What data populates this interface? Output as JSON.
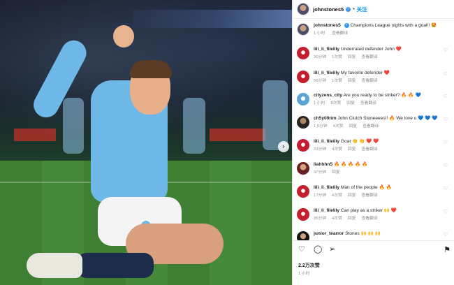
{
  "post": {
    "author": "johnstones5",
    "separator": "•",
    "follow_label": "关注",
    "likes": "2.2万次赞",
    "time": "1 小时"
  },
  "icons": {
    "like": "heart-icon",
    "comment": "comment-icon",
    "share": "send-icon",
    "save": "bookmark-icon",
    "verified": "verified-badge-icon",
    "next_slide": "chevron-right-icon"
  },
  "caption": {
    "user": "johnstones5",
    "text": "Champions League nights with a goal!! 🤩",
    "time": "1 小时",
    "translate": "查看翻译"
  },
  "comments": [
    {
      "user": "lili_li_filelily",
      "text": "Underrated defender John ❤️",
      "time": "30分钟",
      "likes": "1次赞",
      "reply": "回复",
      "translate": "查看翻译",
      "avatar": "red"
    },
    {
      "user": "lili_li_filelily",
      "text": "My favorite defender ❤️",
      "time": "56分钟",
      "likes": "1次赞",
      "reply": "回复",
      "translate": "查看翻译",
      "avatar": "red"
    },
    {
      "user": "cityzens_city",
      "text": "Are you ready to be striker? 🔥 🔥 💙",
      "time": "1 小时",
      "likes": "8次赞",
      "reply": "回复",
      "translate": "查看翻译",
      "avatar": "blue"
    },
    {
      "user": "ch5y09rim",
      "text": "John Clutch Stoneeees!! 🔥 We love u 💙 💙 💙",
      "time": "1 5分钟",
      "likes": "4次赞",
      "reply": "回复",
      "translate": "查看翻译",
      "avatar": "dark"
    },
    {
      "user": "lili_li_filelily",
      "text": "Goat 👏 👏 ❤️ ❤️",
      "time": "33分钟",
      "likes": "4次赞",
      "reply": "回复",
      "translate": "查看翻译",
      "avatar": "red"
    },
    {
      "user": "liahhhn5",
      "text": "🔥 🔥 🔥 🔥 🔥",
      "time": "37分钟",
      "likes": "",
      "reply": "回复",
      "translate": "",
      "avatar": "maroon"
    },
    {
      "user": "lili_li_filelily",
      "text": "Man of the people 🔥 🔥",
      "time": "17分钟",
      "likes": "4次赞",
      "reply": "回复",
      "translate": "查看翻译",
      "avatar": "red"
    },
    {
      "user": "lili_li_filelily",
      "text": "Can play as a striker 🙌 ❤️",
      "time": "35分钟",
      "likes": "4次赞",
      "reply": "回复",
      "translate": "查看翻译",
      "avatar": "red"
    },
    {
      "user": "junior_tearror",
      "text": "Stones 🙌 🙌 🙌",
      "time": "",
      "likes": "",
      "reply": "",
      "translate": "",
      "avatar": "black"
    }
  ]
}
